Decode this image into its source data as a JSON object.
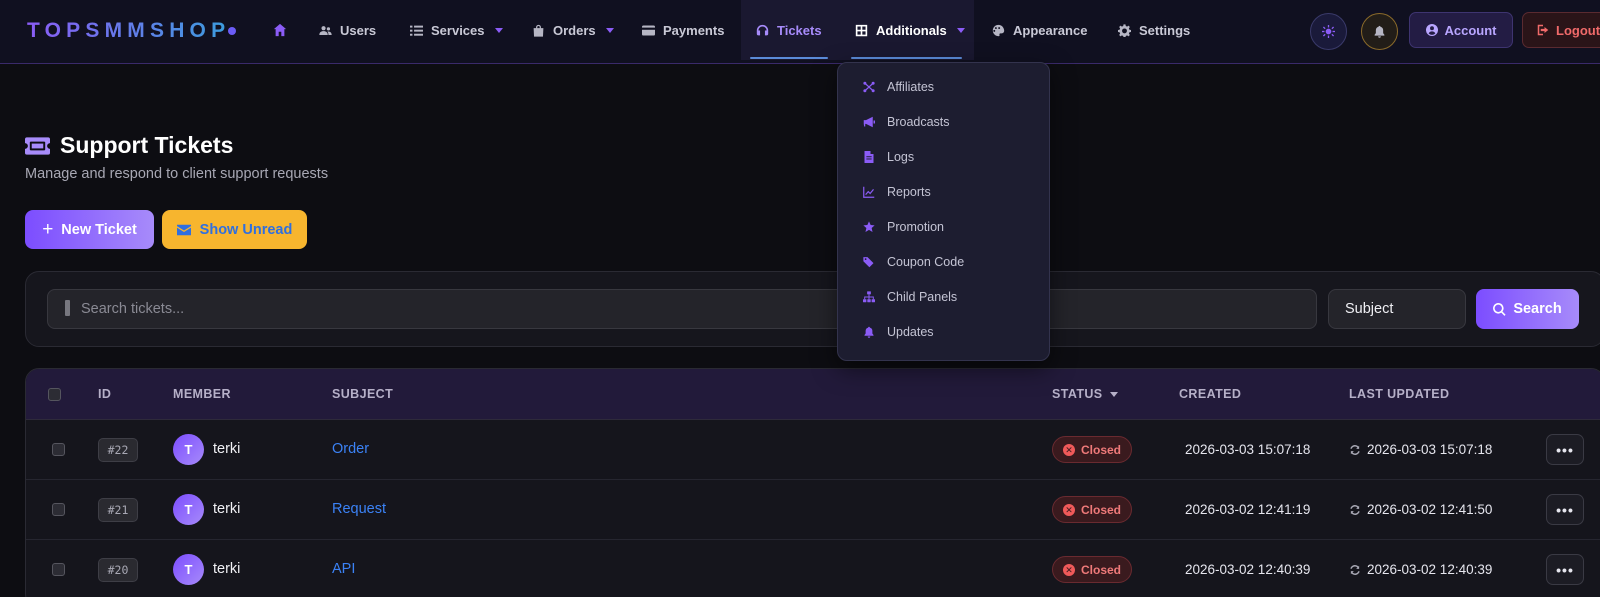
{
  "brand": {
    "logo": "TOPSMMSHOP"
  },
  "nav": {
    "users": "Users",
    "services": "Services",
    "orders": "Orders",
    "payments": "Payments",
    "tickets": "Tickets",
    "additionals": "Additionals",
    "appearance": "Appearance",
    "settings": "Settings",
    "account": "Account",
    "logout": "Logout"
  },
  "dropdown": {
    "items": [
      "Affiliates",
      "Broadcasts",
      "Logs",
      "Reports",
      "Promotion",
      "Coupon Code",
      "Child Panels",
      "Updates"
    ]
  },
  "page": {
    "title": "Support Tickets",
    "subtitle": "Manage and respond to client support requests",
    "new_ticket": "New Ticket",
    "show_unread": "Show Unread"
  },
  "search": {
    "placeholder": "Search tickets...",
    "filter_value": "Subject",
    "button": "Search"
  },
  "table": {
    "headers": {
      "id": "ID",
      "member": "MEMBER",
      "subject": "SUBJECT",
      "status": "STATUS",
      "created": "CREATED",
      "last_updated": "LAST UPDATED"
    },
    "rows": [
      {
        "id": "#22",
        "avatar": "T",
        "member": "terki",
        "subject": "Order",
        "status": "Closed",
        "created": "2026-03-03 15:07:18",
        "updated": "2026-03-03 15:07:18"
      },
      {
        "id": "#21",
        "avatar": "T",
        "member": "terki",
        "subject": "Request",
        "status": "Closed",
        "created": "2026-03-02 12:41:19",
        "updated": "2026-03-02 12:41:50"
      },
      {
        "id": "#20",
        "avatar": "T",
        "member": "terki",
        "subject": "API",
        "status": "Closed",
        "created": "2026-03-02 12:40:39",
        "updated": "2026-03-02 12:40:39"
      }
    ]
  },
  "colors": {
    "accent": "#8b5cf6",
    "warning": "#f7b52e",
    "link": "#3b82f6",
    "danger": "#f05a5a"
  }
}
